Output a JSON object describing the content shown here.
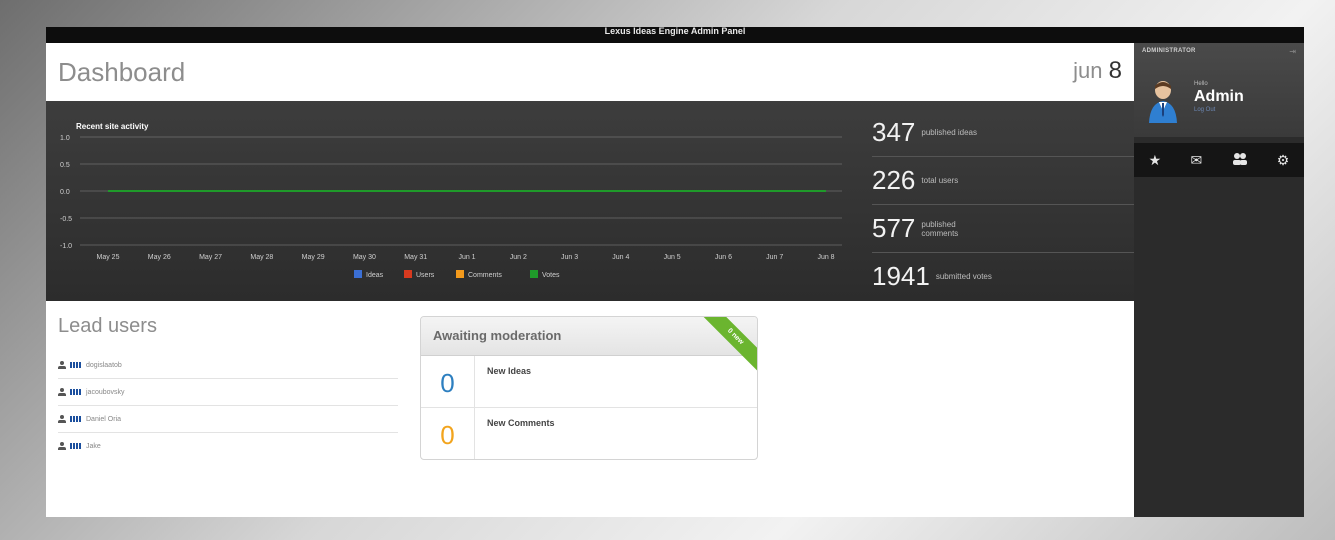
{
  "app": {
    "title": "Lexus Ideas Engine Admin Panel"
  },
  "header": {
    "title": "Dashboard",
    "date_month": "jun",
    "date_day": "8"
  },
  "activity": {
    "title": "Recent site activity",
    "y_ticks": [
      "1.0",
      "0.5",
      "0.0",
      "-0.5",
      "-1.0"
    ],
    "x_ticks": [
      "May 25",
      "May 26",
      "May 27",
      "May 28",
      "May 29",
      "May 30",
      "May 31",
      "Jun 1",
      "Jun 2",
      "Jun 3",
      "Jun 4",
      "Jun 5",
      "Jun 6",
      "Jun 7",
      "Jun 8"
    ],
    "legend": [
      "Ideas",
      "Users",
      "Comments",
      "Votes"
    ]
  },
  "chart_data": {
    "type": "line",
    "title": "Recent site activity",
    "x": [
      "May 25",
      "May 26",
      "May 27",
      "May 28",
      "May 29",
      "May 30",
      "May 31",
      "Jun 1",
      "Jun 2",
      "Jun 3",
      "Jun 4",
      "Jun 5",
      "Jun 6",
      "Jun 7",
      "Jun 8"
    ],
    "ylim": [
      -1,
      1
    ],
    "yticks": [
      1.0,
      0.5,
      0.0,
      -0.5,
      -1.0
    ],
    "grid": true,
    "legend_position": "bottom",
    "series": [
      {
        "name": "Ideas",
        "color": "#3b6fd4",
        "values": [
          0,
          0,
          0,
          0,
          0,
          0,
          0,
          0,
          0,
          0,
          0,
          0,
          0,
          0,
          0
        ]
      },
      {
        "name": "Users",
        "color": "#d83a1f",
        "values": [
          0,
          0,
          0,
          0,
          0,
          0,
          0,
          0,
          0,
          0,
          0,
          0,
          0,
          0,
          0
        ]
      },
      {
        "name": "Comments",
        "color": "#f39a1c",
        "values": [
          0,
          0,
          0,
          0,
          0,
          0,
          0,
          0,
          0,
          0,
          0,
          0,
          0,
          0,
          0
        ]
      },
      {
        "name": "Votes",
        "color": "#1f9a2a",
        "values": [
          0,
          0,
          0,
          0,
          0,
          0,
          0,
          0,
          0,
          0,
          0,
          0,
          0,
          0,
          0
        ]
      }
    ]
  },
  "stats": [
    {
      "value": "347",
      "label": "published ideas"
    },
    {
      "value": "226",
      "label": "total users"
    },
    {
      "value": "577",
      "label": "published comments"
    },
    {
      "value": "1941",
      "label": "submitted votes"
    }
  ],
  "lead_users": {
    "title": "Lead users",
    "items": [
      "dogislaatob",
      "jacoubovsky",
      "Daniel Oria",
      "Jake"
    ]
  },
  "moderation": {
    "title": "Awaiting moderation",
    "ribbon": "0 new",
    "rows": [
      {
        "count": "0",
        "label": "New Ideas",
        "color": "#2d7fc0"
      },
      {
        "count": "0",
        "label": "New Comments",
        "color": "#f2a41d"
      }
    ]
  },
  "sidebar": {
    "role_label": "ADMINISTRATOR",
    "hello": "Hello",
    "name": "Admin",
    "logout": "Log Out",
    "icons": [
      "star-icon",
      "mail-icon",
      "users-icon",
      "gear-icon"
    ]
  }
}
